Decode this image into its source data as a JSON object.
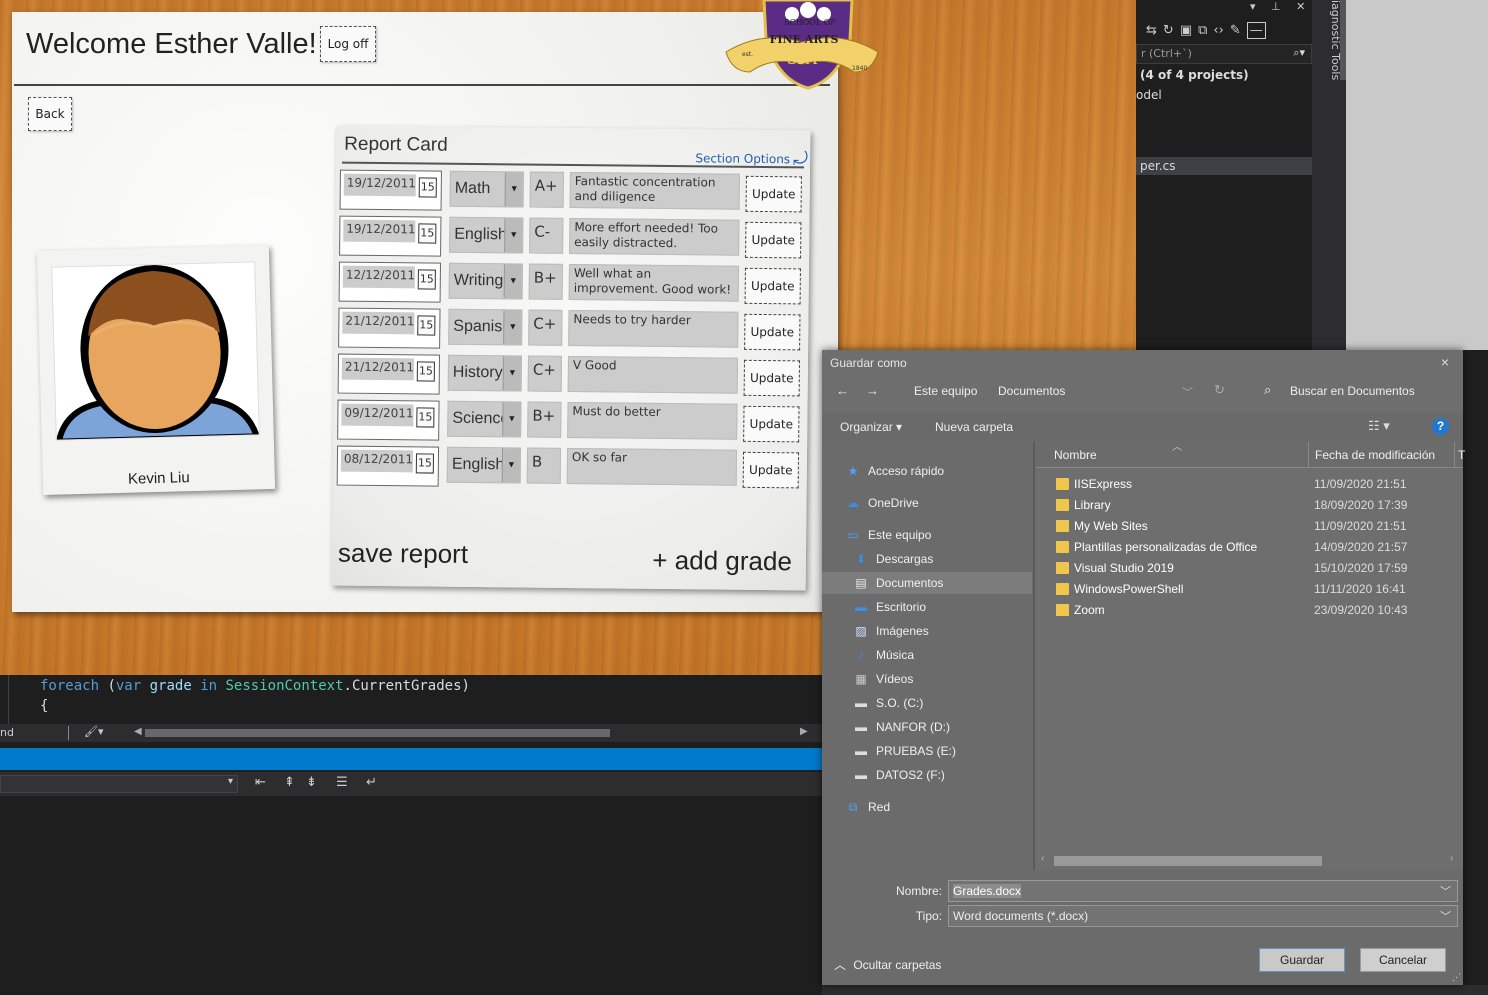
{
  "app": {
    "welcome": "Welcome Esther Valle!",
    "logoff": "Log off",
    "back": "Back",
    "student_name": "Kevin Liu",
    "crest": {
      "line1": "SCHOOL OF",
      "line2": "FINE ARTS",
      "initials": "SFA",
      "est_left": "est.",
      "est_right": "1840"
    },
    "report_card": {
      "title": "Report Card",
      "section_options": "Section Options",
      "save_report": "save report",
      "add_grade": "+ add grade",
      "rows": [
        {
          "date": "19/12/2011",
          "cal": "15",
          "subject": "Math",
          "grade": "A+",
          "comment": "Fantastic concentration and diligence",
          "update": "Update"
        },
        {
          "date": "19/12/2011",
          "cal": "15",
          "subject": "English",
          "grade": "C-",
          "comment": "More effort needed! Too easily distracted.",
          "update": "Update"
        },
        {
          "date": "12/12/2011",
          "cal": "15",
          "subject": "Writing",
          "grade": "B+",
          "comment": "Well what an improvement. Good work!",
          "update": "Update"
        },
        {
          "date": "21/12/2011",
          "cal": "15",
          "subject": "Spanish",
          "grade": "C+",
          "comment": "Needs to try harder",
          "update": "Update"
        },
        {
          "date": "21/12/2011",
          "cal": "15",
          "subject": "History",
          "grade": "C+",
          "comment": "V Good",
          "update": "Update"
        },
        {
          "date": "09/12/2011",
          "cal": "15",
          "subject": "Science",
          "grade": "B+",
          "comment": "Must do better",
          "update": "Update"
        },
        {
          "date": "08/12/2011",
          "cal": "15",
          "subject": "English",
          "grade": "B",
          "comment": "OK so far",
          "update": "Update"
        }
      ]
    }
  },
  "vs": {
    "search_placeholder": "r (Ctrl+`)",
    "solution_text": "(4 of 4 projects)",
    "model_text": "odel",
    "file_text": "per.cs",
    "diagnostic_label": "iagnostic Tools",
    "code_line1": {
      "kw1": "foreach",
      "p1": " (",
      "kw2": "var",
      "p2": " ",
      "id1": "grade",
      "p3": " ",
      "kw3": "in",
      "p4": " ",
      "cls1": "SessionContext",
      "p5": ".CurrentGrades)"
    },
    "code_line2": "{",
    "hscroll_label": "nd"
  },
  "dialog": {
    "title": "Guardar como",
    "close": "×",
    "breadcrumb": [
      "Este equipo",
      "Documentos"
    ],
    "search_placeholder": "Buscar en Documentos",
    "organize": "Organizar",
    "new_folder": "Nueva carpeta",
    "help": "?",
    "nav": [
      {
        "label": "Acceso rápido",
        "icon": "star-icon"
      },
      {
        "label": "OneDrive",
        "icon": "cloud-icon"
      },
      {
        "label": "Este equipo",
        "icon": "computer-icon"
      },
      {
        "label": "Descargas",
        "icon": "download-icon"
      },
      {
        "label": "Documentos",
        "icon": "document-icon"
      },
      {
        "label": "Escritorio",
        "icon": "desktop-icon"
      },
      {
        "label": "Imágenes",
        "icon": "image-icon"
      },
      {
        "label": "Música",
        "icon": "music-icon"
      },
      {
        "label": "Vídeos",
        "icon": "video-icon"
      },
      {
        "label": "S.O. (C:)",
        "icon": "drive-icon"
      },
      {
        "label": "NANFOR (D:)",
        "icon": "drive-icon"
      },
      {
        "label": "PRUEBAS (E:)",
        "icon": "drive-icon"
      },
      {
        "label": "DATOS2 (F:)",
        "icon": "drive-icon"
      },
      {
        "label": "Red",
        "icon": "network-icon"
      }
    ],
    "selected_nav": "Documentos",
    "columns": [
      "Nombre",
      "Fecha de modificación",
      "T"
    ],
    "files": [
      {
        "name": "IISExpress",
        "date": "11/09/2020 21:51"
      },
      {
        "name": "Library",
        "date": "18/09/2020 17:39"
      },
      {
        "name": "My Web Sites",
        "date": "11/09/2020 21:51"
      },
      {
        "name": "Plantillas personalizadas de Office",
        "date": "14/09/2020 21:57"
      },
      {
        "name": "Visual Studio 2019",
        "date": "15/10/2020 17:59"
      },
      {
        "name": "WindowsPowerShell",
        "date": "11/11/2020 16:41"
      },
      {
        "name": "Zoom",
        "date": "23/09/2020 10:43"
      }
    ],
    "filename_label": "Nombre:",
    "filename_value": "Grades.docx",
    "type_label": "Tipo:",
    "type_value": "Word documents (*.docx)",
    "hide_folders": "Ocultar carpetas",
    "save": "Guardar",
    "cancel": "Cancelar"
  }
}
